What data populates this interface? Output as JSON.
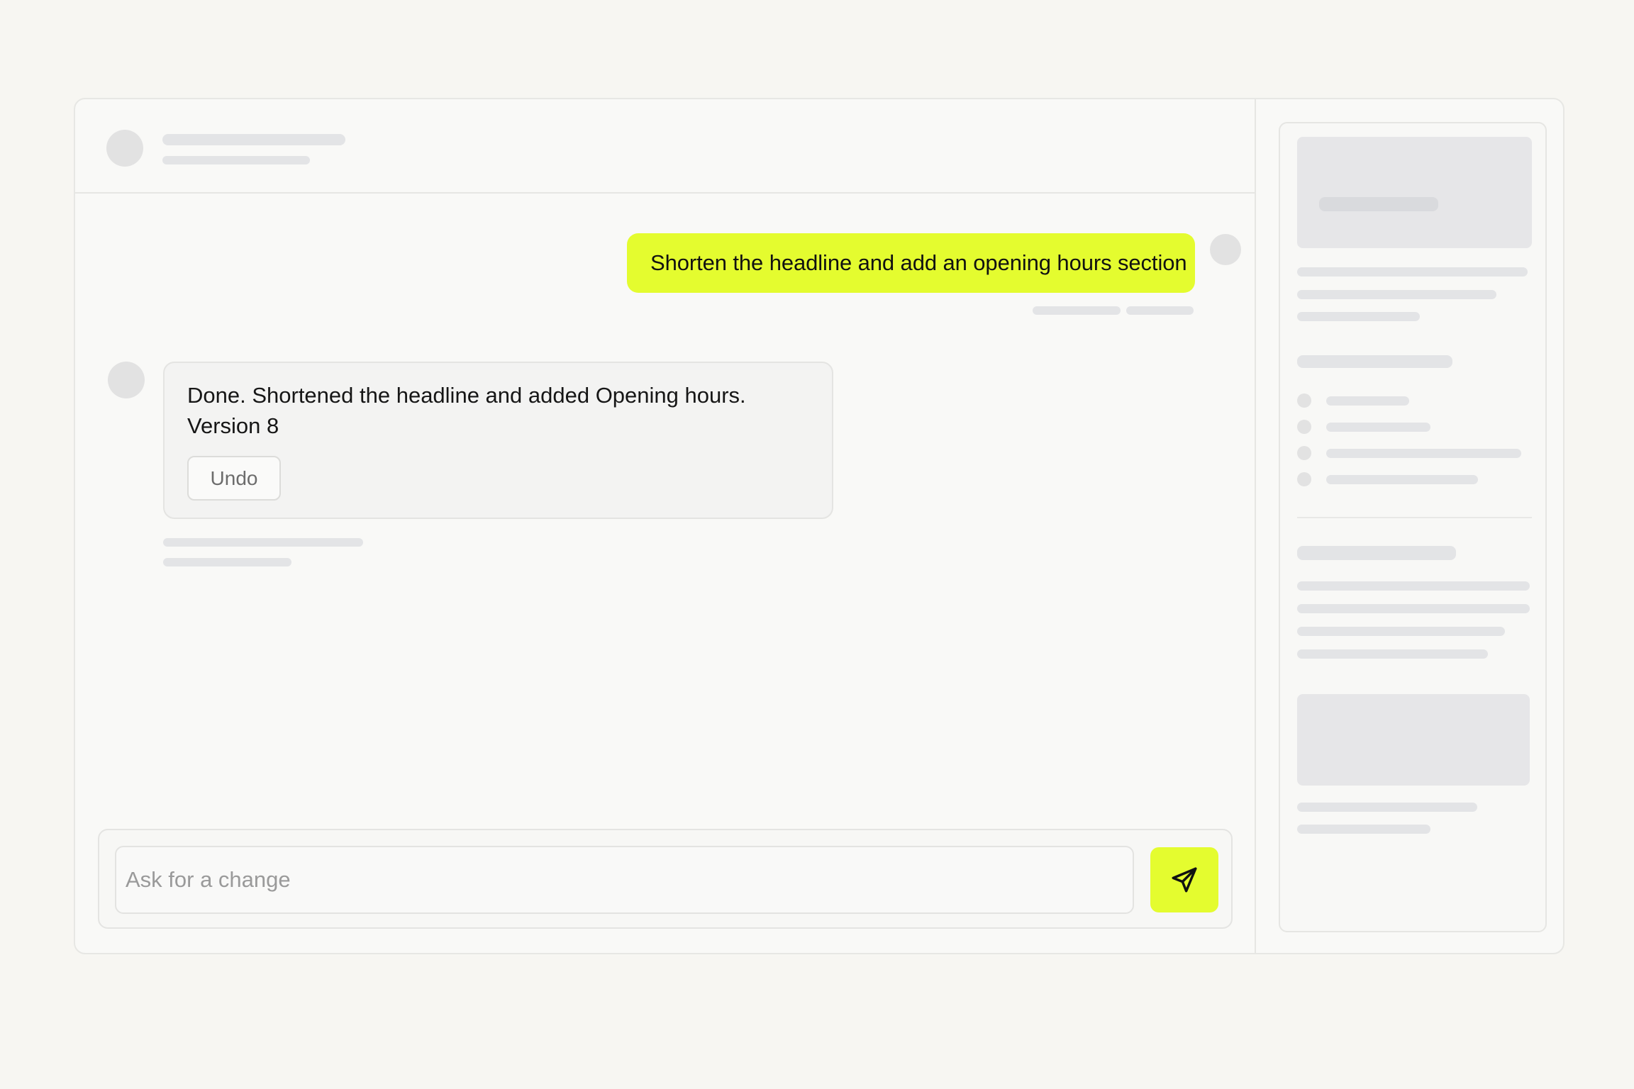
{
  "conversation": {
    "user_message": "Shorten the headline and add an opening hours section",
    "assistant_message": {
      "line1": "Done. Shortened the headline and added Opening hours.",
      "line2": "Version 8",
      "undo_label": "Undo"
    }
  },
  "composer": {
    "placeholder": "Ask for a change",
    "send_icon": "send-icon"
  },
  "colors": {
    "accent": "#e4fc2f",
    "background": "#f7f6f2",
    "skeleton": "#e3e4e6"
  }
}
